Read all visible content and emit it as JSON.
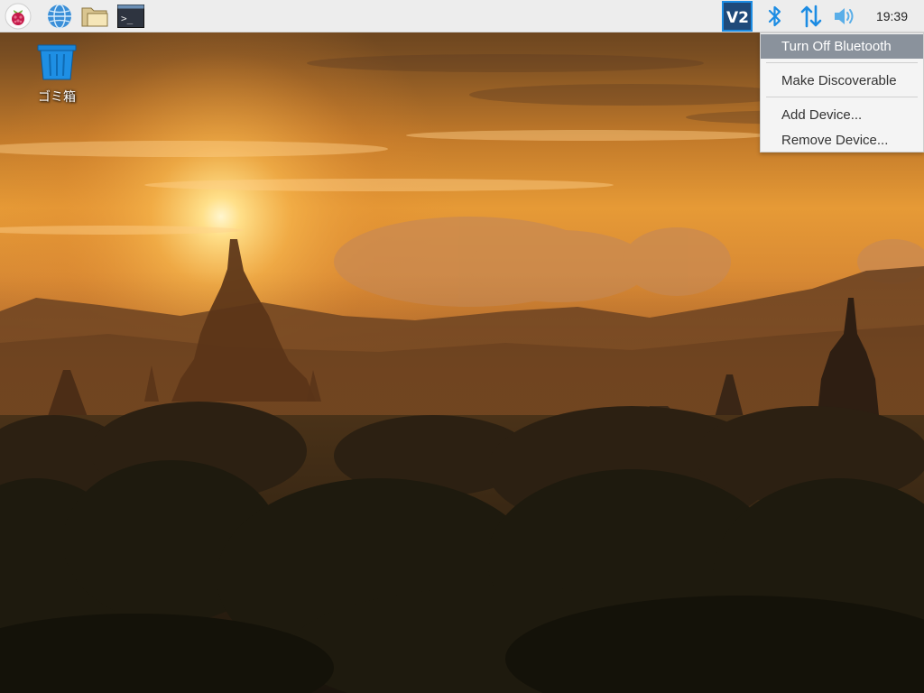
{
  "taskbar": {
    "launchers": [
      {
        "name": "raspberry-menu",
        "icon": "raspberry-icon"
      },
      {
        "name": "web-browser",
        "icon": "globe-icon"
      },
      {
        "name": "file-manager",
        "icon": "folder-icon"
      },
      {
        "name": "terminal",
        "icon": "terminal-icon",
        "glyph": ">_"
      }
    ],
    "tray": [
      {
        "name": "vnc",
        "icon": "vnc-icon",
        "glyph": "V2"
      },
      {
        "name": "bluetooth",
        "icon": "bluetooth-icon"
      },
      {
        "name": "network",
        "icon": "network-arrows-icon"
      },
      {
        "name": "volume",
        "icon": "volume-icon"
      }
    ],
    "clock": "19:39"
  },
  "desktop": {
    "trash_label": "ゴミ箱"
  },
  "bluetooth_menu": {
    "items": [
      {
        "label": "Turn Off Bluetooth",
        "highlighted": true
      },
      {
        "label": "Make Discoverable"
      },
      {
        "label": "Add Device..."
      },
      {
        "label": "Remove Device..."
      }
    ]
  },
  "colors": {
    "taskbar_bg": "#ededed",
    "accent_blue": "#1c8ce3",
    "menu_highlight": "#8a929c"
  }
}
